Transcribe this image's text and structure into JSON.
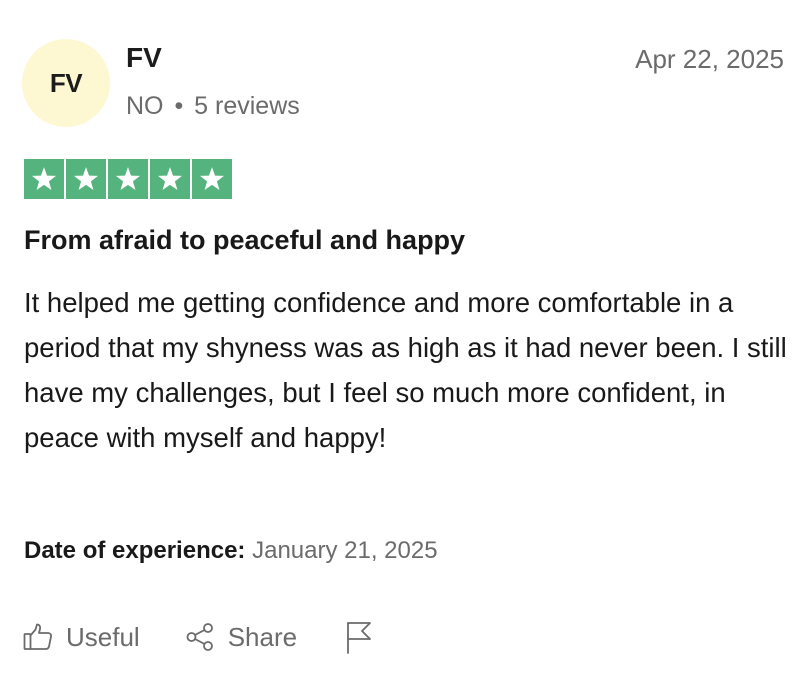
{
  "reviewer": {
    "initials": "FV",
    "name": "FV",
    "country": "NO",
    "separator": "•",
    "reviews_count": "5 reviews"
  },
  "review": {
    "date": "Apr 22, 2025",
    "rating": 5,
    "rating_max": 5,
    "title": "From afraid to peaceful and happy",
    "body": "It helped me getting confidence and more comfortable in a period that my shyness was as high as it had never been. I still have my challenges, but I feel so much more confident, in peace with myself and happy!",
    "experience_label": "Date of experience:",
    "experience_date": "January 21, 2025"
  },
  "actions": {
    "useful_label": "Useful",
    "share_label": "Share"
  },
  "colors": {
    "star_green": "#55b37e",
    "avatar_bg": "#fdf7d2",
    "muted_text": "#6b6b6b"
  },
  "icons": [
    "thumbs-up-icon",
    "share-icon",
    "flag-icon",
    "star-icon"
  ]
}
